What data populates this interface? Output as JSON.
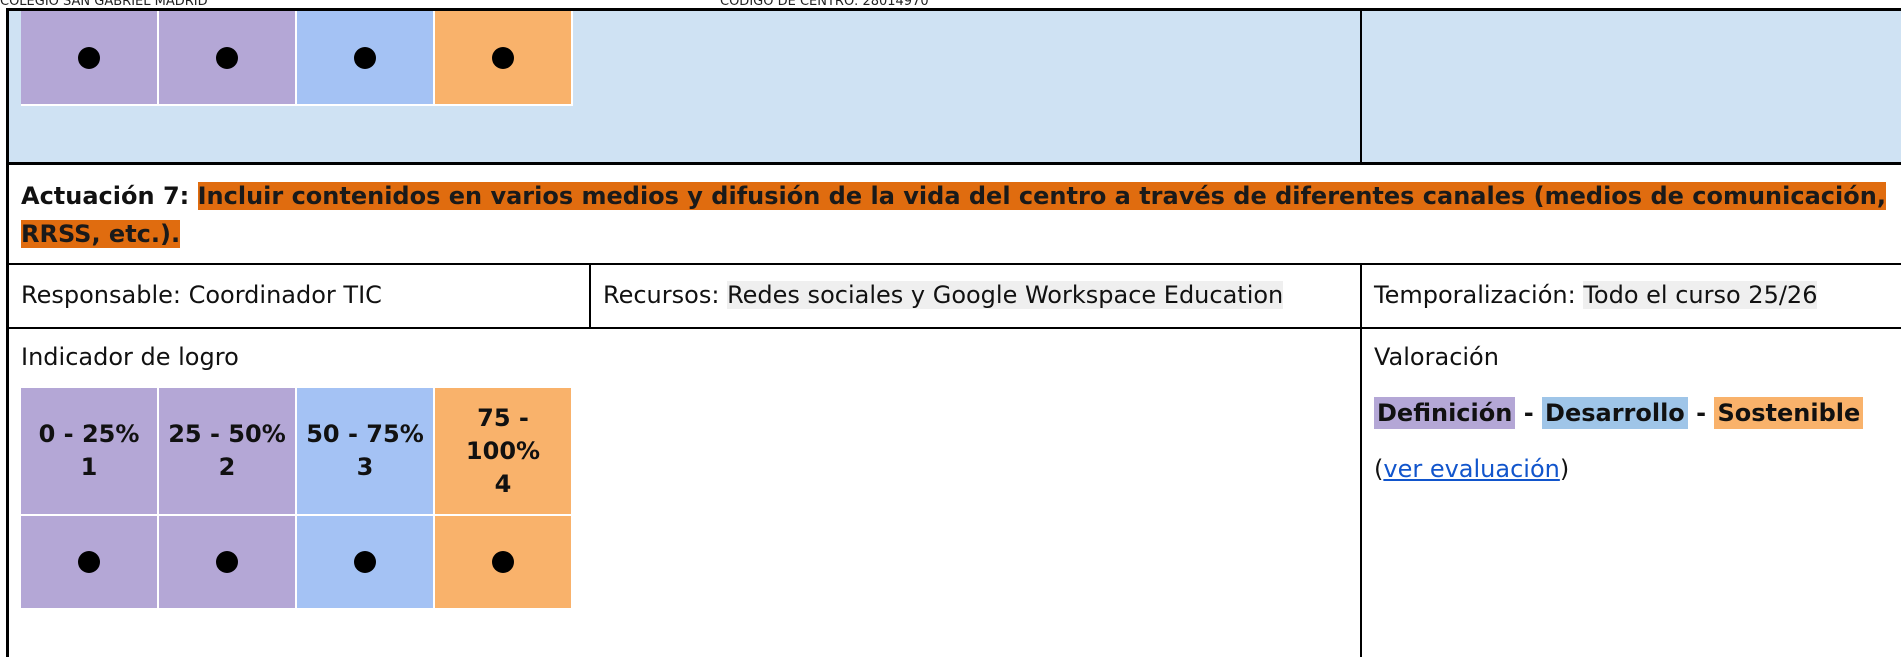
{
  "header": {
    "school": "COLEGIO SAN GABRIEL MADRID",
    "code": "CÓDIGO DE CENTRO: 28014970"
  },
  "top_grid": {
    "colors": [
      "#b4a7d6",
      "#b4a7d6",
      "#a4c2f4",
      "#f9b26b"
    ]
  },
  "actuacion": {
    "label": "Actuación 7:",
    "text": "Incluir contenidos en varios medios y difusión de la vida del centro a través de diferentes canales (medios de comunicación, RRSS, etc.).",
    "highlight_color": "#e06c0f"
  },
  "info": {
    "responsable_label": "Responsable:",
    "responsable_value": "Coordinador TIC",
    "recursos_label": "Recursos:",
    "recursos_value": "Redes sociales y Google Workspace Education",
    "temporalizacion_label": "Temporalización:",
    "temporalizacion_value": "Todo el curso 25/26"
  },
  "indicador": {
    "label": "Indicador de logro",
    "headers": [
      {
        "range": "0 - 25%",
        "level": "1"
      },
      {
        "range": "25 - 50%",
        "level": "2"
      },
      {
        "range": "50 - 75%",
        "level": "3"
      },
      {
        "range": "75 - 100%",
        "level": "4"
      }
    ]
  },
  "valoracion": {
    "label": "Valoración",
    "definicion": "Definición",
    "desarrollo": "Desarrollo",
    "sostenible": "Sostenible",
    "separator": "-",
    "link_open": "(",
    "link_text": "ver evaluación",
    "link_close": ")"
  }
}
